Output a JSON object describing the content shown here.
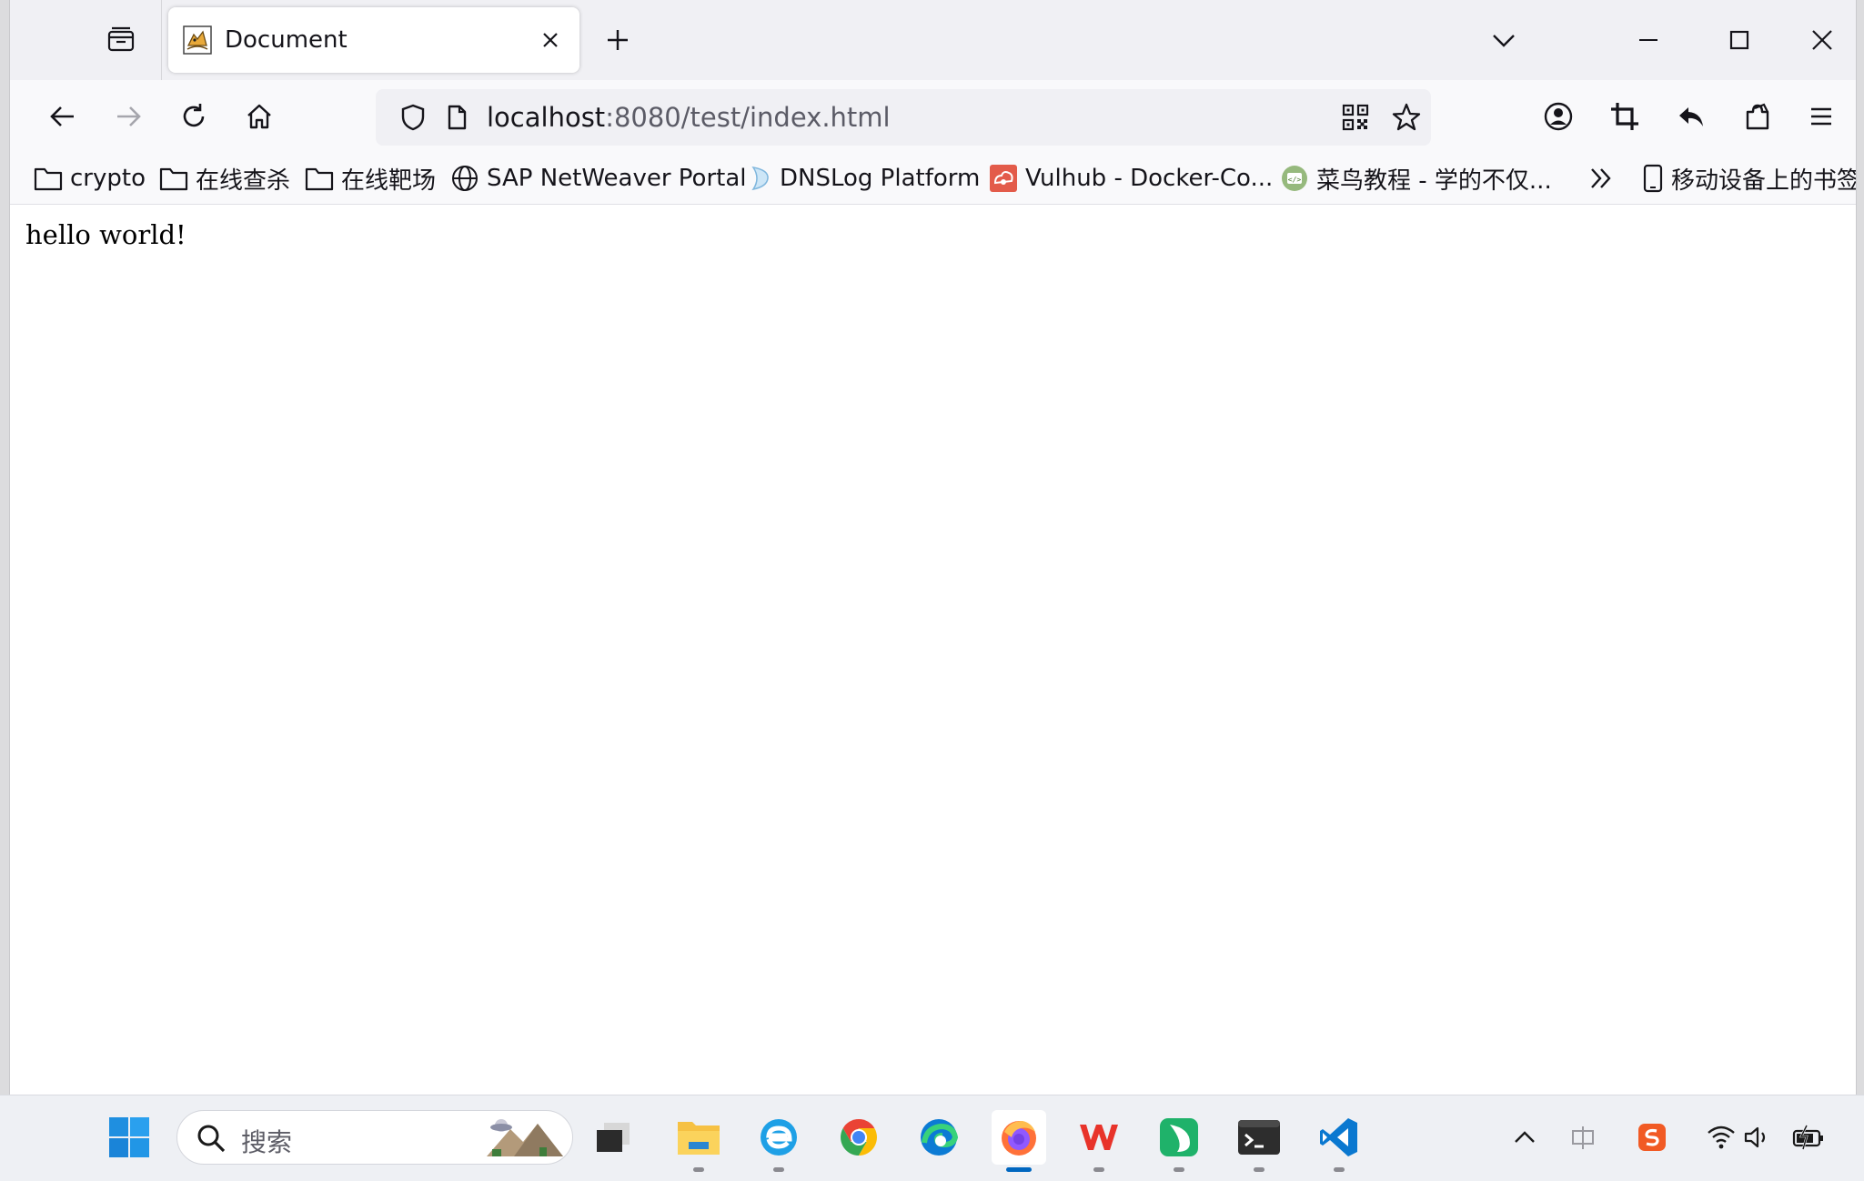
{
  "tab": {
    "title": "Document",
    "favicon": "tomcat-icon"
  },
  "navbar": {
    "url_host": "localhost",
    "url_rest": ":8080/test/index.html"
  },
  "bookmarks": [
    {
      "label": "crypto",
      "icon": "folder-icon"
    },
    {
      "label": "在线查杀",
      "icon": "folder-icon"
    },
    {
      "label": "在线靶场",
      "icon": "folder-icon"
    },
    {
      "label": "SAP NetWeaver Portal",
      "icon": "globe-icon"
    },
    {
      "label": "DNSLog Platform",
      "icon": "dnslog-icon"
    },
    {
      "label": "Vulhub - Docker-Co...",
      "icon": "vulhub-icon"
    },
    {
      "label": "菜鸟教程 - 学的不仅...",
      "icon": "runoob-icon"
    },
    {
      "label": "移动设备上的书签",
      "icon": "mobile-icon"
    }
  ],
  "page": {
    "body_text": "hello world!"
  },
  "taskbar": {
    "search_placeholder": "搜索",
    "apps": [
      "task-view",
      "file-explorer",
      "ie-browser",
      "chrome",
      "edge",
      "firefox",
      "wps",
      "android-tool",
      "terminal",
      "vscode"
    ],
    "active_app": "firefox"
  },
  "colors": {
    "accent": "#0067c0",
    "tab_strip": "#f0f0f4",
    "toolbar": "#f9f9fb"
  }
}
